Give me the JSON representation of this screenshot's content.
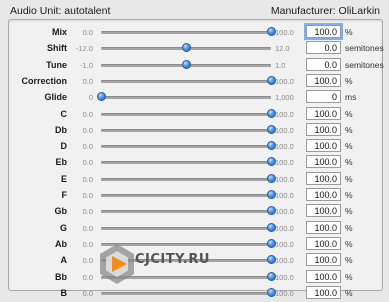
{
  "header": {
    "title": "Audio Unit: autotalent",
    "manufacturer": "Manufacturer: OliLarkin"
  },
  "watermark": {
    "text": "CJCITY.RU"
  },
  "rows": [
    {
      "label": "Mix",
      "min": "0.0",
      "max": "100.0",
      "value": "100.0",
      "unit": "%",
      "level": 1.0,
      "focused": true
    },
    {
      "label": "Shift",
      "min": "-12.0",
      "max": "12.0",
      "value": "0.0",
      "unit": "semitones",
      "level": 0.5
    },
    {
      "label": "Tune",
      "min": "-1.0",
      "max": "1.0",
      "value": "0.0",
      "unit": "semitones",
      "level": 0.5
    },
    {
      "label": "Correction",
      "min": "0.0",
      "max": "100.0",
      "value": "100.0",
      "unit": "%",
      "level": 1.0
    },
    {
      "label": "Glide",
      "min": "0",
      "max": "1,000",
      "value": "0",
      "unit": "ms",
      "level": 0.0
    },
    {
      "label": "C",
      "min": "0.0",
      "max": "100.0",
      "value": "100.0",
      "unit": "%",
      "level": 1.0
    },
    {
      "label": "Db",
      "min": "0.0",
      "max": "100.0",
      "value": "100.0",
      "unit": "%",
      "level": 1.0
    },
    {
      "label": "D",
      "min": "0.0",
      "max": "100.0",
      "value": "100.0",
      "unit": "%",
      "level": 1.0
    },
    {
      "label": "Eb",
      "min": "0.0",
      "max": "100.0",
      "value": "100.0",
      "unit": "%",
      "level": 1.0
    },
    {
      "label": "E",
      "min": "0.0",
      "max": "100.0",
      "value": "100.0",
      "unit": "%",
      "level": 1.0
    },
    {
      "label": "F",
      "min": "0.0",
      "max": "100.0",
      "value": "100.0",
      "unit": "%",
      "level": 1.0
    },
    {
      "label": "Gb",
      "min": "0.0",
      "max": "100.0",
      "value": "100.0",
      "unit": "%",
      "level": 1.0
    },
    {
      "label": "G",
      "min": "0.0",
      "max": "100.0",
      "value": "100.0",
      "unit": "%",
      "level": 1.0
    },
    {
      "label": "Ab",
      "min": "0.0",
      "max": "100.0",
      "value": "100.0",
      "unit": "%",
      "level": 1.0
    },
    {
      "label": "A",
      "min": "0.0",
      "max": "100.0",
      "value": "100.0",
      "unit": "%",
      "level": 1.0
    },
    {
      "label": "Bb",
      "min": "0.0",
      "max": "100.0",
      "value": "100.0",
      "unit": "%",
      "level": 1.0
    },
    {
      "label": "B",
      "min": "0.0",
      "max": "100.0",
      "value": "100.0",
      "unit": "%",
      "level": 1.0
    }
  ]
}
